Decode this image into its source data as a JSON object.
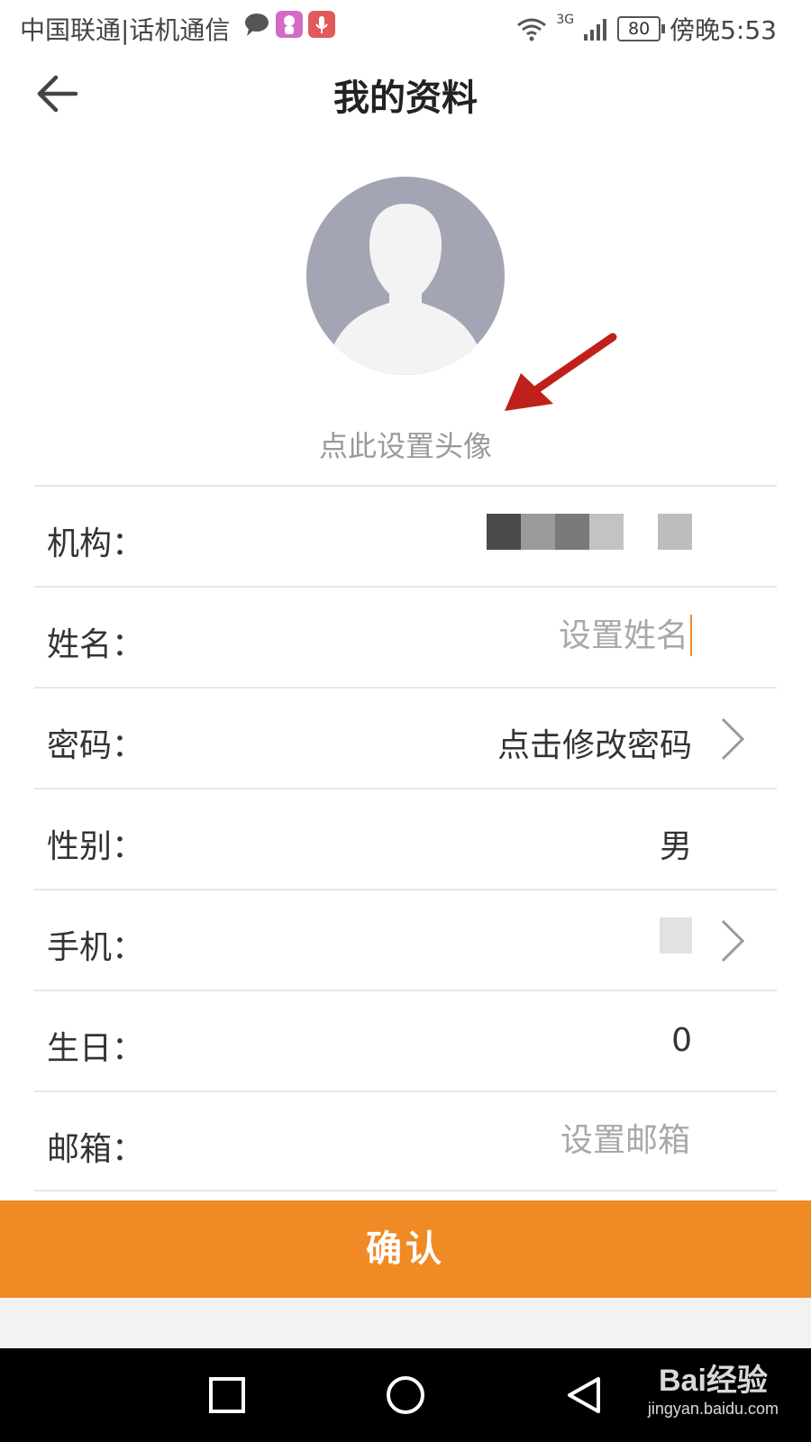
{
  "status_bar": {
    "carrier": "中国联通|话机通信",
    "network": "3G",
    "battery": "80",
    "time": "傍晚5:53"
  },
  "header": {
    "title": "我的资料",
    "back_icon": "arrow-left-icon"
  },
  "avatar": {
    "hint": "点此设置头像"
  },
  "form": {
    "rows": [
      {
        "label": "机构：",
        "value": ""
      },
      {
        "label": "姓名：",
        "placeholder": "设置姓名",
        "value": ""
      },
      {
        "label": "密码：",
        "value": "点击修改密码",
        "has_chevron": true
      },
      {
        "label": "性别：",
        "value": "男"
      },
      {
        "label": "手机：",
        "value": "",
        "has_chevron": true
      },
      {
        "label": "生日：",
        "value": "0"
      },
      {
        "label": "邮箱：",
        "placeholder": "设置邮箱",
        "value": ""
      }
    ]
  },
  "confirm": {
    "label": "确认"
  },
  "watermark": {
    "brand": "Bai经验",
    "url": "jingyan.baidu.com"
  },
  "colors": {
    "accent": "#f08a24",
    "annotation_arrow": "#c0201c",
    "avatar_bg": "#a3a5b4"
  }
}
